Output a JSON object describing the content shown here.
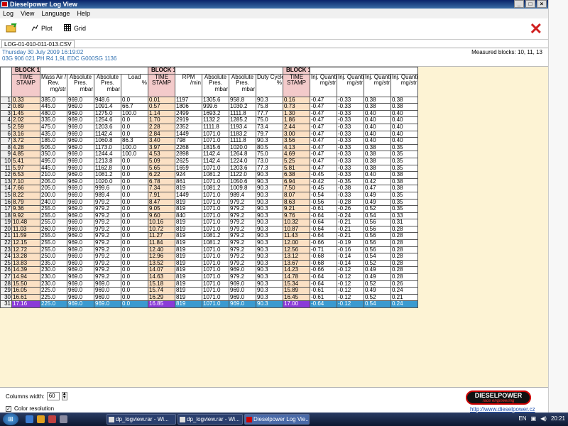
{
  "window": {
    "title": "Dieselpower Log View",
    "controls": [
      "_",
      "□",
      "×"
    ]
  },
  "menu": [
    "Log",
    "View",
    "Language",
    "Help"
  ],
  "toolbar": {
    "plot": "Plot",
    "grid": "Grid"
  },
  "file_tab": "LOG-01-010-011-013.CSV",
  "info": {
    "date": "Thursday 30 July 2009 16:19:02",
    "ecu": "03G 906 021 PH  R4 1,9L EDC G000SG  1136",
    "measured": "Measured blocks: 10, 11, 13"
  },
  "blocks": [
    {
      "label": "BLOCK 10",
      "span": 5
    },
    {
      "label": "BLOCK 11",
      "span": 5
    },
    {
      "label": "BLOCK 13",
      "span": 5
    }
  ],
  "columns": [
    {
      "l1": "TIME",
      "l2": "STAMP",
      "unit": "",
      "ts": true
    },
    {
      "l1": "Mass Air /",
      "l2": "Rev.",
      "unit": "mg/str"
    },
    {
      "l1": "Absolute",
      "l2": "Pres.",
      "unit": "mbar"
    },
    {
      "l1": "Absolute",
      "l2": "Pres.",
      "unit": "mbar"
    },
    {
      "l1": "Load",
      "l2": "",
      "unit": "%"
    },
    {
      "l1": "TIME",
      "l2": "STAMP",
      "unit": "",
      "ts": true
    },
    {
      "l1": "RPM",
      "l2": "",
      "unit": "/min"
    },
    {
      "l1": "Absolute",
      "l2": "Pres.",
      "unit": "mbar"
    },
    {
      "l1": "Absolute",
      "l2": "Pres.",
      "unit": "mbar"
    },
    {
      "l1": "Duty Cycle",
      "l2": "",
      "unit": "%"
    },
    {
      "l1": "TIME",
      "l2": "STAMP",
      "unit": "",
      "ts": true
    },
    {
      "l1": "Inj. Quantity",
      "l2": "",
      "unit": "mg/str"
    },
    {
      "l1": "Inj. Quantity",
      "l2": "",
      "unit": "mg/str"
    },
    {
      "l1": "Inj. Quantity",
      "l2": "",
      "unit": "mg/str"
    },
    {
      "l1": "Inj. Quantity",
      "l2": "",
      "unit": "mg/str"
    }
  ],
  "rows": [
    [
      "0.33",
      "385.0",
      "969.0",
      "948.6",
      "0.0",
      "0.01",
      "1197",
      "1305.6",
      "958.8",
      "90.3",
      "0.16",
      "-0.47",
      "-0.33",
      "0.38",
      "0.38"
    ],
    [
      "0.89",
      "445.0",
      "969.0",
      "1091.4",
      "66.7",
      "0.57",
      "1806",
      "999.6",
      "1030.2",
      "75.8",
      "0.73",
      "-0.47",
      "-0.33",
      "0.38",
      "0.38"
    ],
    [
      "1.45",
      "480.0",
      "969.0",
      "1275.0",
      "100.0",
      "1.14",
      "2499",
      "1693.2",
      "1111.8",
      "77.7",
      "1.30",
      "-0.47",
      "-0.33",
      "0.40",
      "0.40"
    ],
    [
      "2.02",
      "335.0",
      "969.0",
      "1254.6",
      "0.0",
      "1.70",
      "2919",
      "1132.2",
      "1285.2",
      "75.0",
      "1.86",
      "-0.47",
      "-0.33",
      "0.40",
      "0.40"
    ],
    [
      "2.59",
      "475.0",
      "969.0",
      "1203.6",
      "0.0",
      "2.28",
      "2352",
      "1111.8",
      "1193.4",
      "73.4",
      "2.44",
      "-0.47",
      "-0.33",
      "0.40",
      "0.40"
    ],
    [
      "3.16",
      "435.0",
      "969.0",
      "1142.4",
      "0.0",
      "2.84",
      "1449",
      "1071.0",
      "1183.2",
      "79.7",
      "3.00",
      "-0.47",
      "-0.33",
      "0.40",
      "0.40"
    ],
    [
      "3.72",
      "185.0",
      "969.0",
      "1060.8",
      "86.3",
      "3.40",
      "798",
      "1071.0",
      "1111.8",
      "90.3",
      "3.56",
      "-0.47",
      "-0.33",
      "0.40",
      "0.40"
    ],
    [
      "4.28",
      "505.0",
      "969.0",
      "1173.0",
      "100.0",
      "3.97",
      "2268",
      "1815.6",
      "1020.0",
      "80.5",
      "4.13",
      "-0.47",
      "-0.33",
      "0.38",
      "0.35"
    ],
    [
      "4.85",
      "350.0",
      "969.0",
      "1244.4",
      "100.0",
      "4.53",
      "2898",
      "1142.4",
      "1264.8",
      "75.0",
      "4.69",
      "-0.47",
      "-0.33",
      "0.38",
      "0.35"
    ],
    [
      "5.41",
      "495.0",
      "969.0",
      "1213.8",
      "0.0",
      "5.09",
      "2625",
      "1142.4",
      "1224.0",
      "73.0",
      "5.25",
      "-0.47",
      "-0.33",
      "0.38",
      "0.35"
    ],
    [
      "5.97",
      "445.0",
      "969.0",
      "1162.8",
      "0.0",
      "5.65",
      "1659",
      "1071.0",
      "1203.6",
      "77.3",
      "5.81",
      "-0.47",
      "-0.33",
      "0.38",
      "0.35"
    ],
    [
      "6.53",
      "210.0",
      "969.0",
      "1081.2",
      "0.0",
      "6.22",
      "924",
      "1081.2",
      "1122.0",
      "90.3",
      "6.38",
      "-0.45",
      "-0.33",
      "0.40",
      "0.38"
    ],
    [
      "7.10",
      "205.0",
      "969.0",
      "1020.0",
      "0.0",
      "6.78",
      "861",
      "1071.0",
      "1050.6",
      "90.3",
      "6.94",
      "-0.42",
      "-0.35",
      "0.42",
      "0.38"
    ],
    [
      "7.66",
      "205.0",
      "969.0",
      "999.6",
      "0.0",
      "7.34",
      "819",
      "1081.2",
      "1009.8",
      "90.3",
      "7.50",
      "-0.45",
      "-0.38",
      "0.47",
      "0.38"
    ],
    [
      "8.22",
      "200.0",
      "969.0",
      "989.4",
      "0.0",
      "7.91",
      "1449",
      "1071.0",
      "989.4",
      "90.3",
      "8.07",
      "-0.54",
      "-0.33",
      "0.49",
      "0.35"
    ],
    [
      "8.79",
      "240.0",
      "969.0",
      "979.2",
      "0.0",
      "8.47",
      "819",
      "1071.0",
      "979.2",
      "90.3",
      "8.63",
      "-0.56",
      "-0.28",
      "0.49",
      "0.35"
    ],
    [
      "9.36",
      "255.0",
      "969.0",
      "979.2",
      "0.0",
      "9.05",
      "819",
      "1071.0",
      "979.2",
      "90.3",
      "9.21",
      "-0.61",
      "-0.26",
      "0.52",
      "0.35"
    ],
    [
      "9.92",
      "255.0",
      "969.0",
      "979.2",
      "0.0",
      "9.60",
      "840",
      "1071.0",
      "979.2",
      "90.3",
      "9.76",
      "-0.64",
      "-0.24",
      "0.54",
      "0.33"
    ],
    [
      "10.48",
      "255.0",
      "969.0",
      "979.2",
      "0.0",
      "10.16",
      "819",
      "1071.0",
      "979.2",
      "90.3",
      "10.32",
      "-0.64",
      "-0.21",
      "0.56",
      "0.31"
    ],
    [
      "11.03",
      "260.0",
      "969.0",
      "979.2",
      "0.0",
      "10.72",
      "819",
      "1071.0",
      "979.2",
      "90.3",
      "10.87",
      "-0.64",
      "-0.21",
      "0.56",
      "0.28"
    ],
    [
      "11.59",
      "255.0",
      "969.0",
      "979.2",
      "0.0",
      "11.27",
      "819",
      "1081.2",
      "979.2",
      "90.3",
      "11.43",
      "-0.64",
      "-0.21",
      "0.56",
      "0.28"
    ],
    [
      "12.15",
      "255.0",
      "969.0",
      "979.2",
      "0.0",
      "11.84",
      "819",
      "1081.2",
      "979.2",
      "90.3",
      "12.00",
      "-0.66",
      "-0.19",
      "0.56",
      "0.28"
    ],
    [
      "12.72",
      "255.0",
      "969.0",
      "979.2",
      "0.0",
      "12.40",
      "819",
      "1071.0",
      "979.2",
      "90.3",
      "12.56",
      "-0.71",
      "-0.16",
      "0.56",
      "0.28"
    ],
    [
      "13.28",
      "250.0",
      "969.0",
      "979.2",
      "0.0",
      "12.96",
      "819",
      "1071.0",
      "979.2",
      "90.3",
      "13.12",
      "-0.68",
      "-0.14",
      "0.54",
      "0.28"
    ],
    [
      "13.83",
      "235.0",
      "969.0",
      "979.2",
      "0.0",
      "13.52",
      "819",
      "1071.0",
      "979.2",
      "90.3",
      "13.67",
      "-0.68",
      "-0.14",
      "0.52",
      "0.28"
    ],
    [
      "14.39",
      "230.0",
      "969.0",
      "979.2",
      "0.0",
      "14.07",
      "819",
      "1071.0",
      "969.0",
      "90.3",
      "14.23",
      "-0.66",
      "-0.12",
      "0.49",
      "0.28"
    ],
    [
      "14.94",
      "230.0",
      "969.0",
      "979.2",
      "0.0",
      "14.63",
      "819",
      "1071.0",
      "979.2",
      "90.3",
      "14.78",
      "-0.64",
      "-0.12",
      "0.49",
      "0.28"
    ],
    [
      "15.50",
      "230.0",
      "969.0",
      "969.0",
      "0.0",
      "15.18",
      "819",
      "1071.0",
      "969.0",
      "90.3",
      "15.34",
      "-0.64",
      "-0.12",
      "0.52",
      "0.26"
    ],
    [
      "16.05",
      "225.0",
      "969.0",
      "969.0",
      "0.0",
      "15.74",
      "819",
      "1071.0",
      "969.0",
      "90.3",
      "15.89",
      "-0.61",
      "-0.12",
      "0.49",
      "0.24"
    ],
    [
      "16.61",
      "225.0",
      "969.0",
      "969.0",
      "0.0",
      "16.29",
      "819",
      "1071.0",
      "969.0",
      "90.3",
      "16.45",
      "-0.61",
      "-0.12",
      "0.52",
      "0.21"
    ],
    [
      "17.16",
      "225.0",
      "969.0",
      "969.0",
      "0.0",
      "16.85",
      "819",
      "1071.0",
      "969.0",
      "90.3",
      "17.00",
      "-0.64",
      "-0.12",
      "0.54",
      "0.24"
    ]
  ],
  "bottom": {
    "colwidth_label": "Columns width:",
    "colwidth_value": "60",
    "color_res_label": "Color resolution",
    "logo_main": "DIESELPOWER",
    "logo_sub": "race engineering",
    "url": "http://www.dieselpower.cz"
  },
  "taskbar": {
    "tasks": [
      "dp_logview.rar - Wi...",
      "dp_logview.rar - Wi...",
      "Dieselpower Log Vie..."
    ],
    "lang": "EN",
    "time": "20:21"
  },
  "colors": {
    "timestamp_cell": "#fbe0c4",
    "selected_row": "#3a9ad0",
    "selected_timestamp": "#8a3ad8",
    "block_header": "#f0c8c8",
    "grid_area": "#fdf3d4"
  }
}
